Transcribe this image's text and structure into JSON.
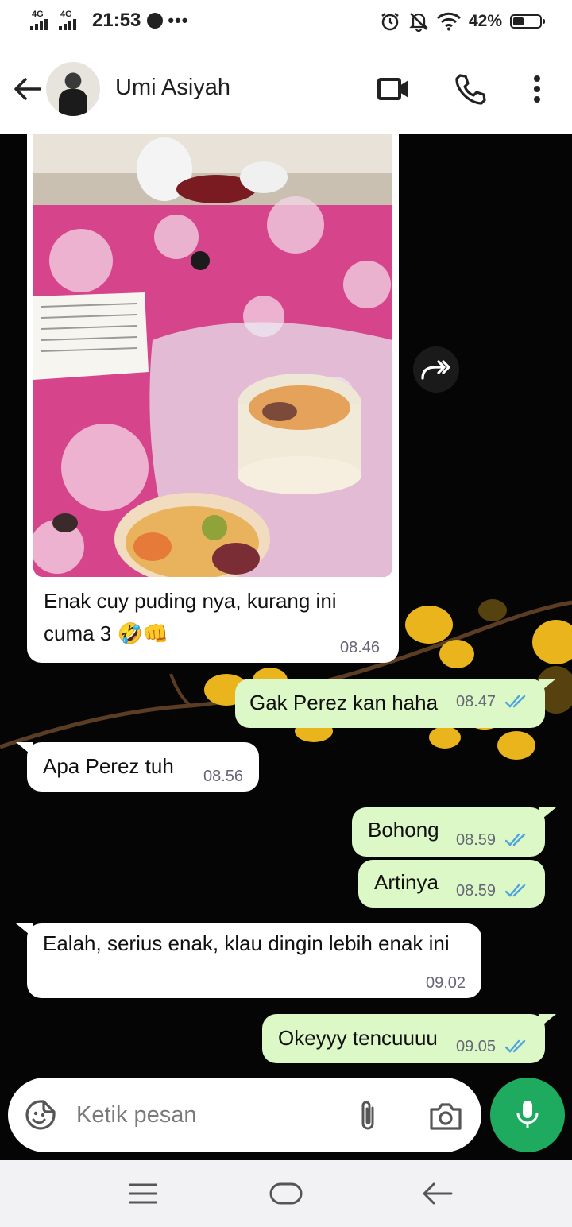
{
  "status_bar": {
    "signal1_label": "4G",
    "signal2_label": "4G",
    "time": "21:53",
    "more_indicator": "•••",
    "battery_percent": "42%",
    "battery_level": 0.42,
    "icons": [
      "alarm-icon",
      "mute-notification-icon",
      "wifi-icon",
      "battery-icon"
    ]
  },
  "header": {
    "contact_name": "Umi Asiyah",
    "icons": [
      "back-arrow-icon",
      "video-call-icon",
      "phone-call-icon",
      "more-vert-icon"
    ]
  },
  "messages": [
    {
      "direction": "in",
      "type": "image",
      "caption": "Enak cuy puding nya, kurang ini cuma 3 🤣👊",
      "time": "08.46"
    },
    {
      "direction": "out",
      "text": "Gak Perez kan haha",
      "time": "08.47",
      "status": "read"
    },
    {
      "direction": "in",
      "text": "Apa Perez tuh",
      "time": "08.56"
    },
    {
      "direction": "out",
      "text": "Bohong",
      "time": "08.59",
      "status": "read"
    },
    {
      "direction": "out",
      "text": "Artinya",
      "time": "08.59",
      "status": "read"
    },
    {
      "direction": "in",
      "text": "Ealah, serius enak, klau dingin lebih enak ini",
      "time": "09.02"
    },
    {
      "direction": "out",
      "text": "Okeyyy tencuuuu",
      "time": "09.05",
      "status": "read"
    }
  ],
  "composer": {
    "placeholder": "Ketik pesan",
    "icons": [
      "sticker-icon",
      "attach-icon",
      "camera-icon",
      "mic-icon"
    ]
  },
  "colors": {
    "incoming_bubble": "#ffffff",
    "outgoing_bubble": "#dcf8c6",
    "read_tick": "#4fa3e0",
    "mic_button": "#1eaa5f"
  }
}
